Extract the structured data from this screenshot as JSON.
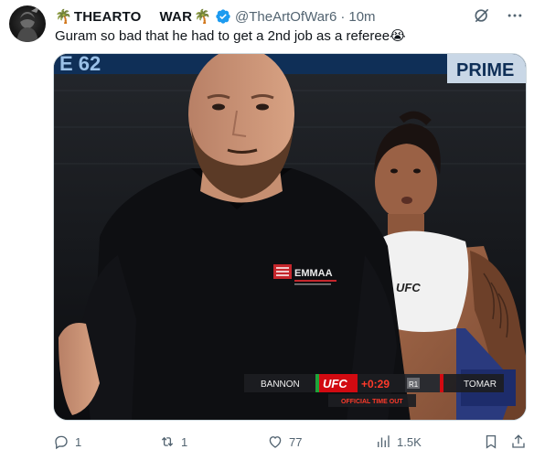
{
  "tweet": {
    "display_name": "THEARTO WAR",
    "name_part1": "THEARTO",
    "name_part2": "WAR",
    "emoji_palm": "🌴",
    "handle": "@TheArtOfWar6",
    "separator": "·",
    "time": "10m",
    "text": "Guram so bad that he had to get a 2nd job as a referee😭"
  },
  "media": {
    "scoreboard": {
      "fighter_left": "BANNON",
      "brand": "UFC",
      "time_added": "+0:29",
      "round": "R1",
      "fighter_right": "TOMAR",
      "status": "OFFICIAL TIME OUT"
    },
    "shirt_logo": "EMMAA",
    "sports_bra_logo": "UFC",
    "banner_text": "PRIME",
    "banner_text_left": "E 62"
  },
  "actions": {
    "replies": "1",
    "reposts": "1",
    "likes": "77",
    "views": "1.5K"
  },
  "colors": {
    "verified": "#1d9bf0",
    "muted": "#536471",
    "text": "#0f1419"
  }
}
